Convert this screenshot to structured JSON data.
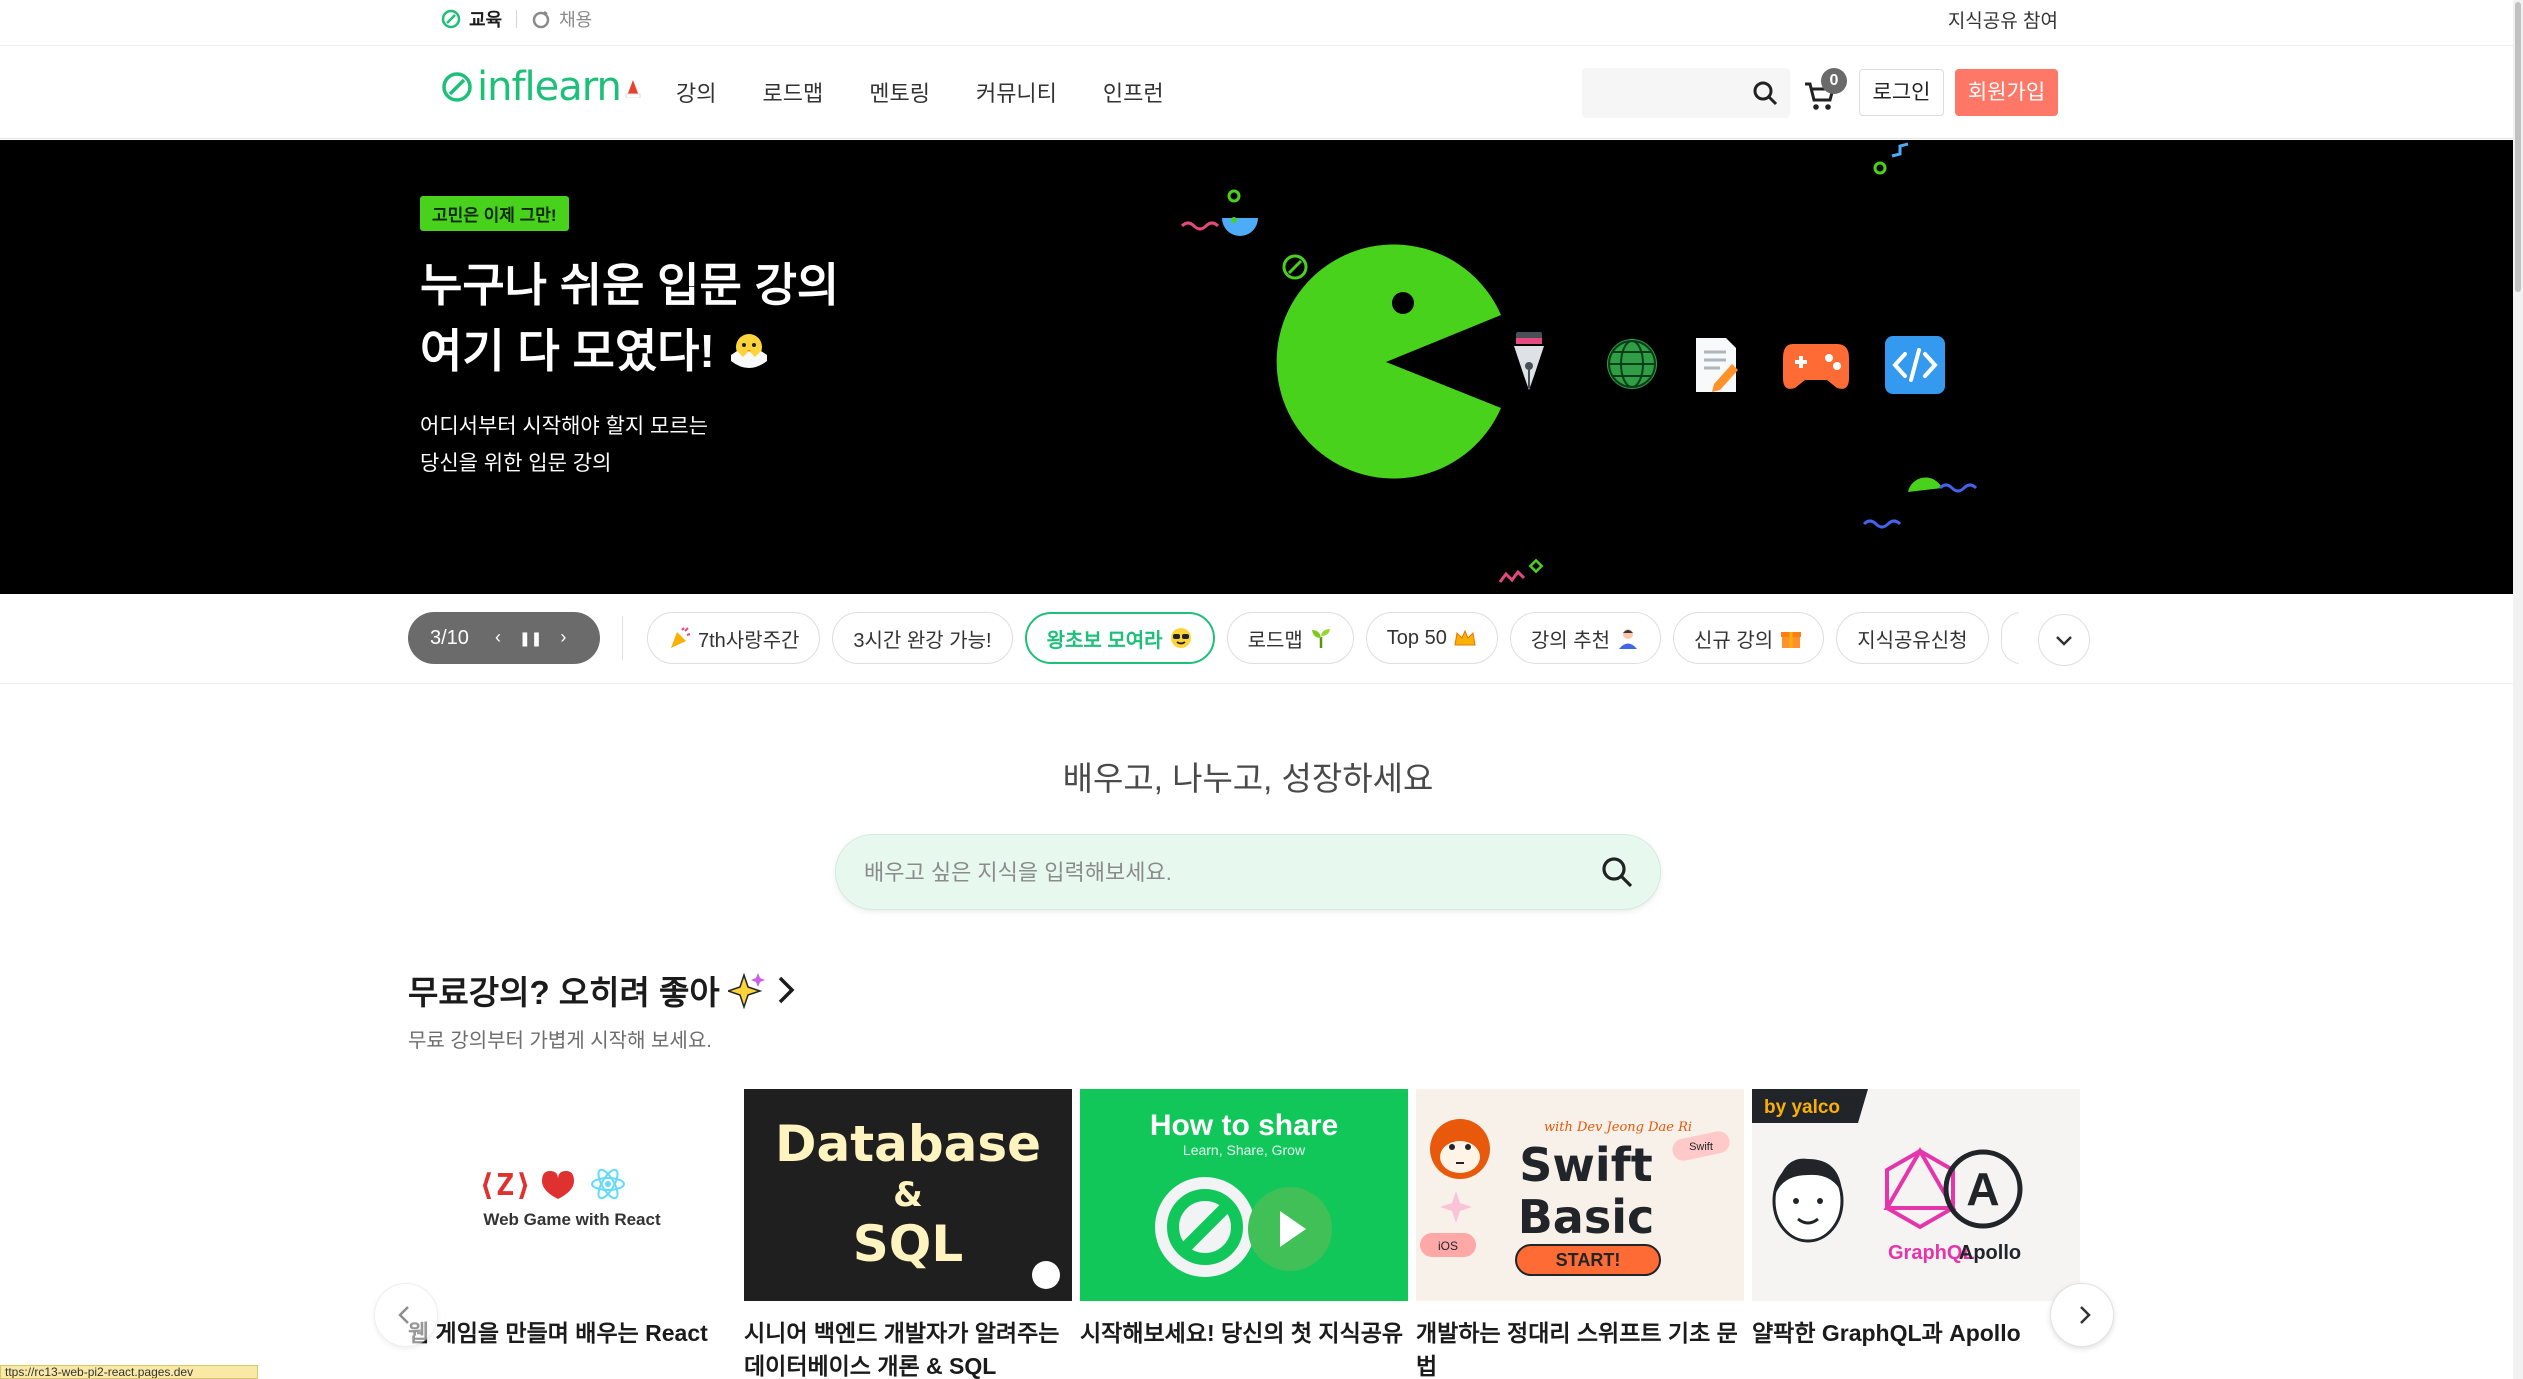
{
  "util": {
    "edu": "교육",
    "hire": "채용",
    "share": "지식공유 참여"
  },
  "header": {
    "logo": "inflearn",
    "nav": [
      "강의",
      "로드맵",
      "멘토링",
      "커뮤니티",
      "인프런"
    ],
    "search_placeholder": "",
    "cart_count": "0",
    "login": "로그인",
    "signup": "회원가입",
    "accent": "#1dc078",
    "signup_color": "#ff7867"
  },
  "hero": {
    "tag": "고민은 이제 그만!",
    "title_line1": "누구나 쉬운 입문 강의",
    "title_line2": "여기 다 모였다!",
    "sub_line1": "어디서부터 시작해야 할지 모르는",
    "sub_line2": "당신을 위한 입문 강의",
    "pacman_color": "#49d21c"
  },
  "chipbar": {
    "pager": "3/10",
    "chips": [
      {
        "label": "7th사랑주간",
        "icon": "party-icon"
      },
      {
        "label": "3시간 완강 가능!",
        "icon": ""
      },
      {
        "label": "왕초보 모여라",
        "icon": "cool-face-icon"
      },
      {
        "label": "로드맵",
        "icon": "sprout-icon"
      },
      {
        "label": "Top 50",
        "icon": "crown-icon"
      },
      {
        "label": "강의 추천",
        "icon": "person-icon"
      },
      {
        "label": "신규 강의",
        "icon": "gift-icon"
      },
      {
        "label": "지식공유신청",
        "icon": ""
      }
    ],
    "active_index": 2
  },
  "main": {
    "tagline": "배우고, 나누고, 성장하세요",
    "search_placeholder": "배우고 싶은 지식을 입력해보세요."
  },
  "section": {
    "title": "무료강의? 오히려 좋아",
    "subtitle": "무료 강의부터 가볍게 시작해 보세요.",
    "cards": [
      {
        "title": "웹 게임을 만들며 배우는 React",
        "thumb_text": "Web Game with React"
      },
      {
        "title": "시니어 백엔드 개발자가 알려주는 데이터베이스 개론 & SQL",
        "thumb_line1": "Database",
        "thumb_line2": "&",
        "thumb_line3": "SQL"
      },
      {
        "title": "시작해보세요! 당신의 첫 지식공유",
        "thumb_line1": "How to share",
        "thumb_line2": "Learn, Share, Grow"
      },
      {
        "title": "개발하는 정대리 스위프트 기초 문법",
        "thumb_line1": "Swift",
        "thumb_line2": "Basic",
        "thumb_line3": "START!",
        "thumb_small": "with Dev Jeong Dae Ri",
        "thumb_tag1": "Swift",
        "thumb_tag2": "iOS"
      },
      {
        "title": "얄팍한 GraphQL과 Apollo",
        "thumb_badge": "by yalco",
        "thumb_line1": "GraphQL",
        "thumb_line2": "Apollo"
      }
    ]
  },
  "status_url": "ttps://rc13-web-pi2-react.pages.dev"
}
